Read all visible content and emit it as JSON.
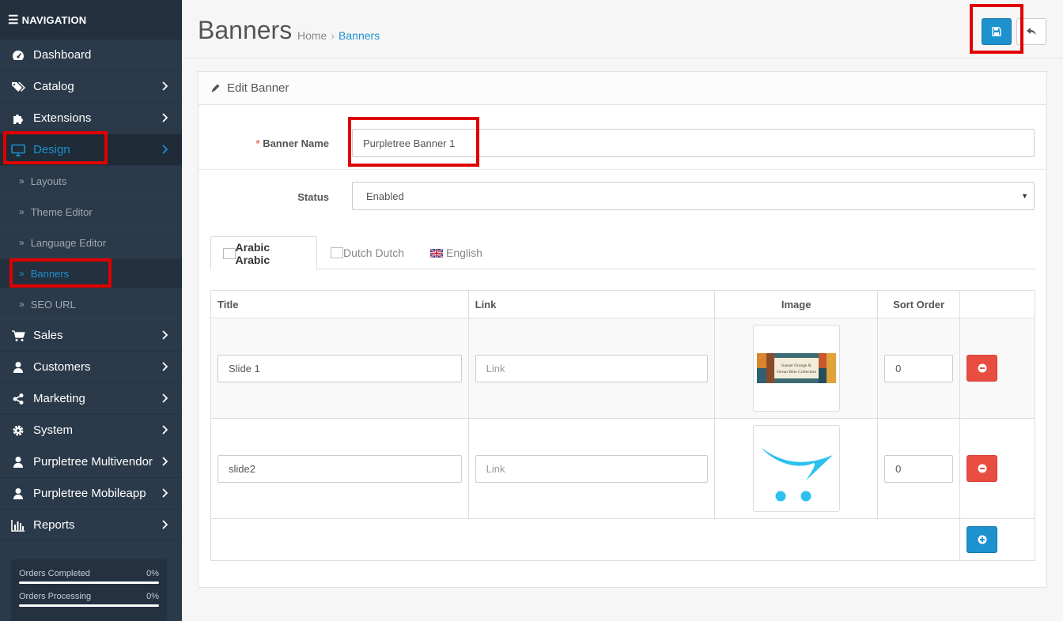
{
  "nav": {
    "header": "NAVIGATION",
    "items": [
      {
        "label": "Dashboard",
        "icon": "dashboard-icon"
      },
      {
        "label": "Catalog",
        "icon": "tags-icon"
      },
      {
        "label": "Extensions",
        "icon": "puzzle-icon"
      },
      {
        "label": "Design",
        "icon": "monitor-icon"
      },
      {
        "label": "Sales",
        "icon": "cart-icon"
      },
      {
        "label": "Customers",
        "icon": "user-icon"
      },
      {
        "label": "Marketing",
        "icon": "share-icon"
      },
      {
        "label": "System",
        "icon": "gear-icon"
      },
      {
        "label": "Purpletree Multivendor",
        "icon": "user-icon"
      },
      {
        "label": "Purpletree Mobileapp",
        "icon": "user-icon"
      },
      {
        "label": "Reports",
        "icon": "bar-chart-icon"
      }
    ],
    "design_sub": [
      "Layouts",
      "Theme Editor",
      "Language Editor",
      "Banners",
      "SEO URL"
    ]
  },
  "stats": [
    {
      "label": "Orders Completed",
      "value": "0%"
    },
    {
      "label": "Orders Processing",
      "value": "0%"
    }
  ],
  "header": {
    "title": "Banners",
    "breadcrumb": [
      "Home",
      "Banners"
    ]
  },
  "panel": {
    "heading": "Edit Banner",
    "banner_name_label": "Banner Name",
    "banner_name_value": "Purpletree Banner 1",
    "status_label": "Status",
    "status_value": "Enabled"
  },
  "tabs": [
    {
      "label": "Arabic Arabic"
    },
    {
      "label": "Dutch Dutch"
    },
    {
      "label": "English"
    }
  ],
  "table": {
    "headers": [
      "Title",
      "Link",
      "Image",
      "Sort Order"
    ],
    "rows": [
      {
        "title": "Slide 1",
        "link_placeholder": "Link",
        "sort_order": "0",
        "image_caption": "Sunset Orange & Ocean Blue Collection"
      },
      {
        "title": "slide2",
        "link_placeholder": "Link",
        "sort_order": "0"
      }
    ]
  },
  "colors": {
    "accent": "#1e91cf",
    "danger": "#e84e40",
    "sidebar": "#2b3a4a",
    "highlight": "#e00000"
  }
}
